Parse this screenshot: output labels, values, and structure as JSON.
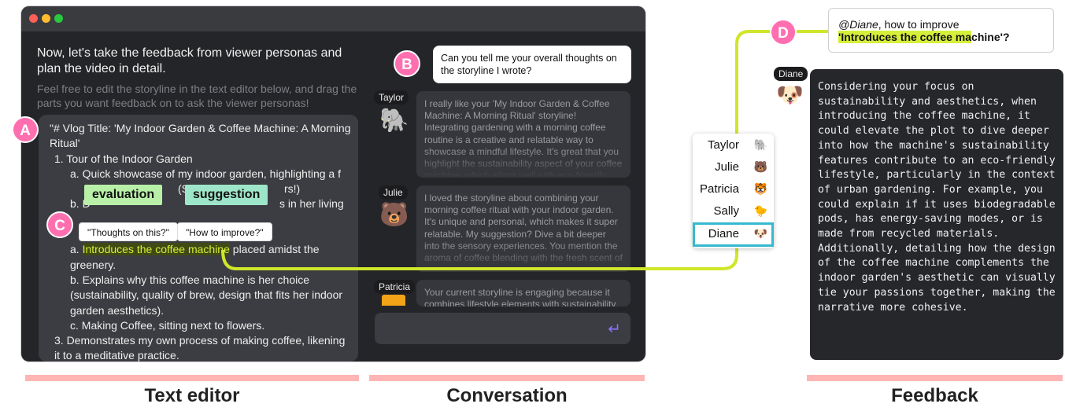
{
  "editor_panel": {
    "intro": "Now, let's take the feedback from viewer personas and plan the video in detail.",
    "sub": "Feel free to edit the storyline in the text editor below, and drag the parts you want feedback on to ask the viewer personas!",
    "lines": [
      "\"# Vlog Title: 'My Indoor Garden & Coffee Machine: A Morning Ritual'",
      "1. Tour of the Indoor Garden",
      "a. Quick showcase of my indoor garden, highlighting a f",
      "(S",
      "rs!)",
      "b. D",
      "s in her living",
      "a. ",
      "Introduces the coffee machine",
      " placed amidst the greenery.",
      "b. Explains why this coffee machine is her choice (sustainability, quality of brew, design that fits her indoor garden aesthetics).",
      "c. Making Coffee, sitting next to flowers.",
      "3. Demonstrates my own process of making coffee, likening it to a meditative practice."
    ],
    "tags": {
      "evaluation": "evaluation",
      "suggestion": "suggestion"
    },
    "pills": {
      "thoughts": "\"Thoughts on this?\"",
      "improve": "\"How to improve?\""
    }
  },
  "badges": {
    "a": "A",
    "b": "B",
    "c": "C",
    "d": "D"
  },
  "conversation": {
    "question": "Can you tell me your overall thoughts on the storyline I wrote?",
    "messages": [
      {
        "speaker": "Taylor",
        "text": "I really like your 'My Indoor Garden & Coffee Machine: A Morning Ritual' storyline! Integrating gardening with a morning coffee routine is a creative and relatable way to showcase a mindful lifestyle. It's great that you highlight the sustainability aspect of your coffee machine, which aligns well with eco-friendly trends."
      },
      {
        "speaker": "Julie",
        "text": "I loved the storyline about combining your morning coffee ritual with your indoor garden. It's unique and personal, which makes it super relatable. My suggestion? Dive a bit deeper into the sensory experiences. You mention the aroma of coffee blending with the fresh scent of plants."
      },
      {
        "speaker": "Patricia",
        "text": "Your current storyline is engaging because it combines lifestyle elements with sustainability."
      }
    ],
    "send_icon": "return-arrow-icon"
  },
  "personas": [
    {
      "name": "Taylor",
      "icon": "elephant-icon"
    },
    {
      "name": "Julie",
      "icon": "bear-icon"
    },
    {
      "name": "Patricia",
      "icon": "tiger-icon"
    },
    {
      "name": "Sally",
      "icon": "chick-icon"
    },
    {
      "name": "Diane",
      "icon": "dog-icon",
      "selected": true
    }
  ],
  "feedback": {
    "mention": "@Diane",
    "question_rest": ", how to improve",
    "quote_hl": "'Introduces the coffee ma",
    "quote_rest": "chine'?",
    "speaker": "Diane",
    "response": "Considering your focus on sustainability and aesthetics, when introducing the coffee machine, it could elevate the plot to dive deeper into how the machine's sustainability features contribute to an eco-friendly lifestyle, particularly in the context of urban gardening. For example, you could explain if it uses biodegradable pods, has energy-saving modes, or is made from recycled materials. Additionally, detailing how the design of the coffee machine complements the indoor garden's aesthetic can visually tie your passions together, making the narrative more cohesive."
  },
  "captions": {
    "editor": "Text editor",
    "conversation": "Conversation",
    "feedback": "Feedback"
  },
  "colors": {
    "accent_pink": "#ff6fb0",
    "lime": "#cfe62a",
    "selected": "#35b9d1",
    "evaluation": "#b8f0a8",
    "suggestion": "#9ee6c9"
  }
}
